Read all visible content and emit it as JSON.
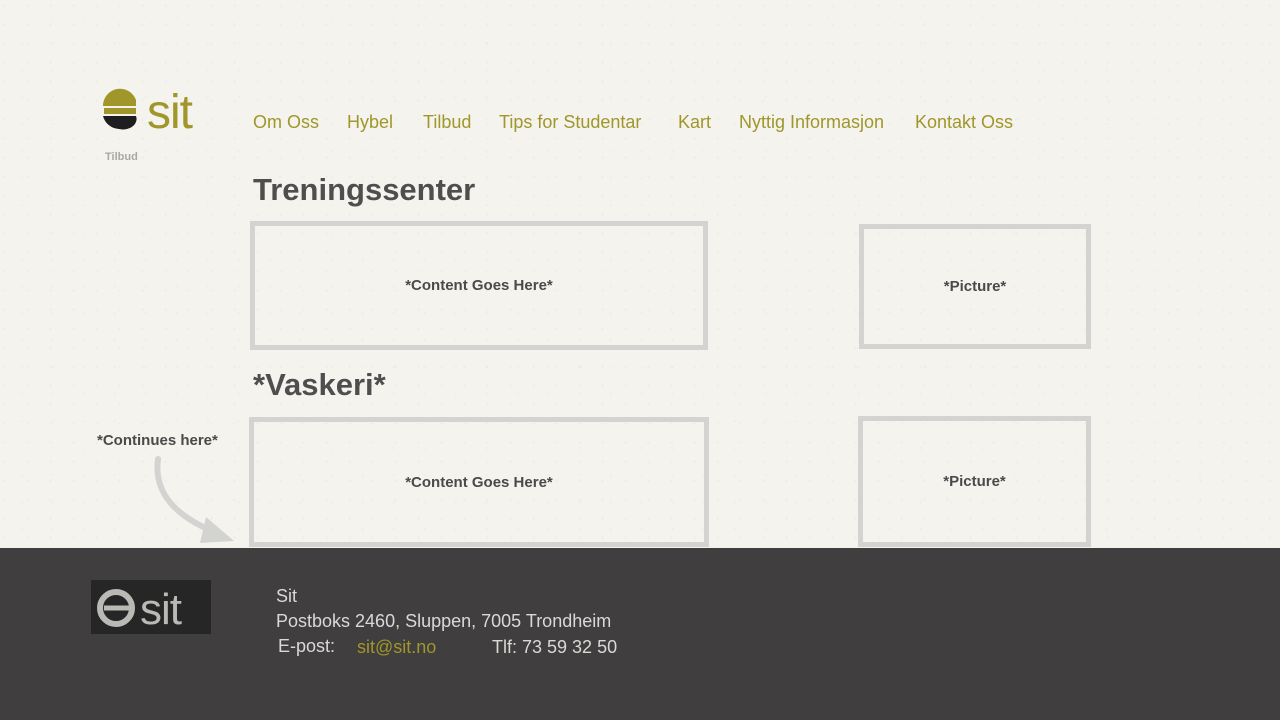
{
  "brand": {
    "logo_text": "sit",
    "accent_color": "#a0962a",
    "dark_color": "#1e1e1e"
  },
  "breadcrumb": "Tilbud",
  "nav": {
    "items": [
      {
        "label": "Om Oss"
      },
      {
        "label": "Hybel"
      },
      {
        "label": "Tilbud"
      },
      {
        "label": "Tips for Studentar"
      },
      {
        "label": "Kart"
      },
      {
        "label": "Nyttig Informasjon"
      },
      {
        "label": "Kontakt Oss"
      }
    ]
  },
  "sections": [
    {
      "title": "Treningssenter",
      "content_placeholder": "*Content Goes Here*",
      "picture_placeholder": "*Picture*"
    },
    {
      "title": "*Vaskeri*",
      "content_placeholder": "*Content Goes Here*",
      "picture_placeholder": "*Picture*"
    }
  ],
  "continues_note": "*Continues here*",
  "footer": {
    "logo_text": "sit",
    "name": "Sit",
    "address": "Postboks 2460, Sluppen, 7005 Trondheim",
    "email_label": "E-post:",
    "email": "sit@sit.no",
    "phone": "Tlf: 73 59 32 50",
    "background_color": "#403e3f"
  }
}
